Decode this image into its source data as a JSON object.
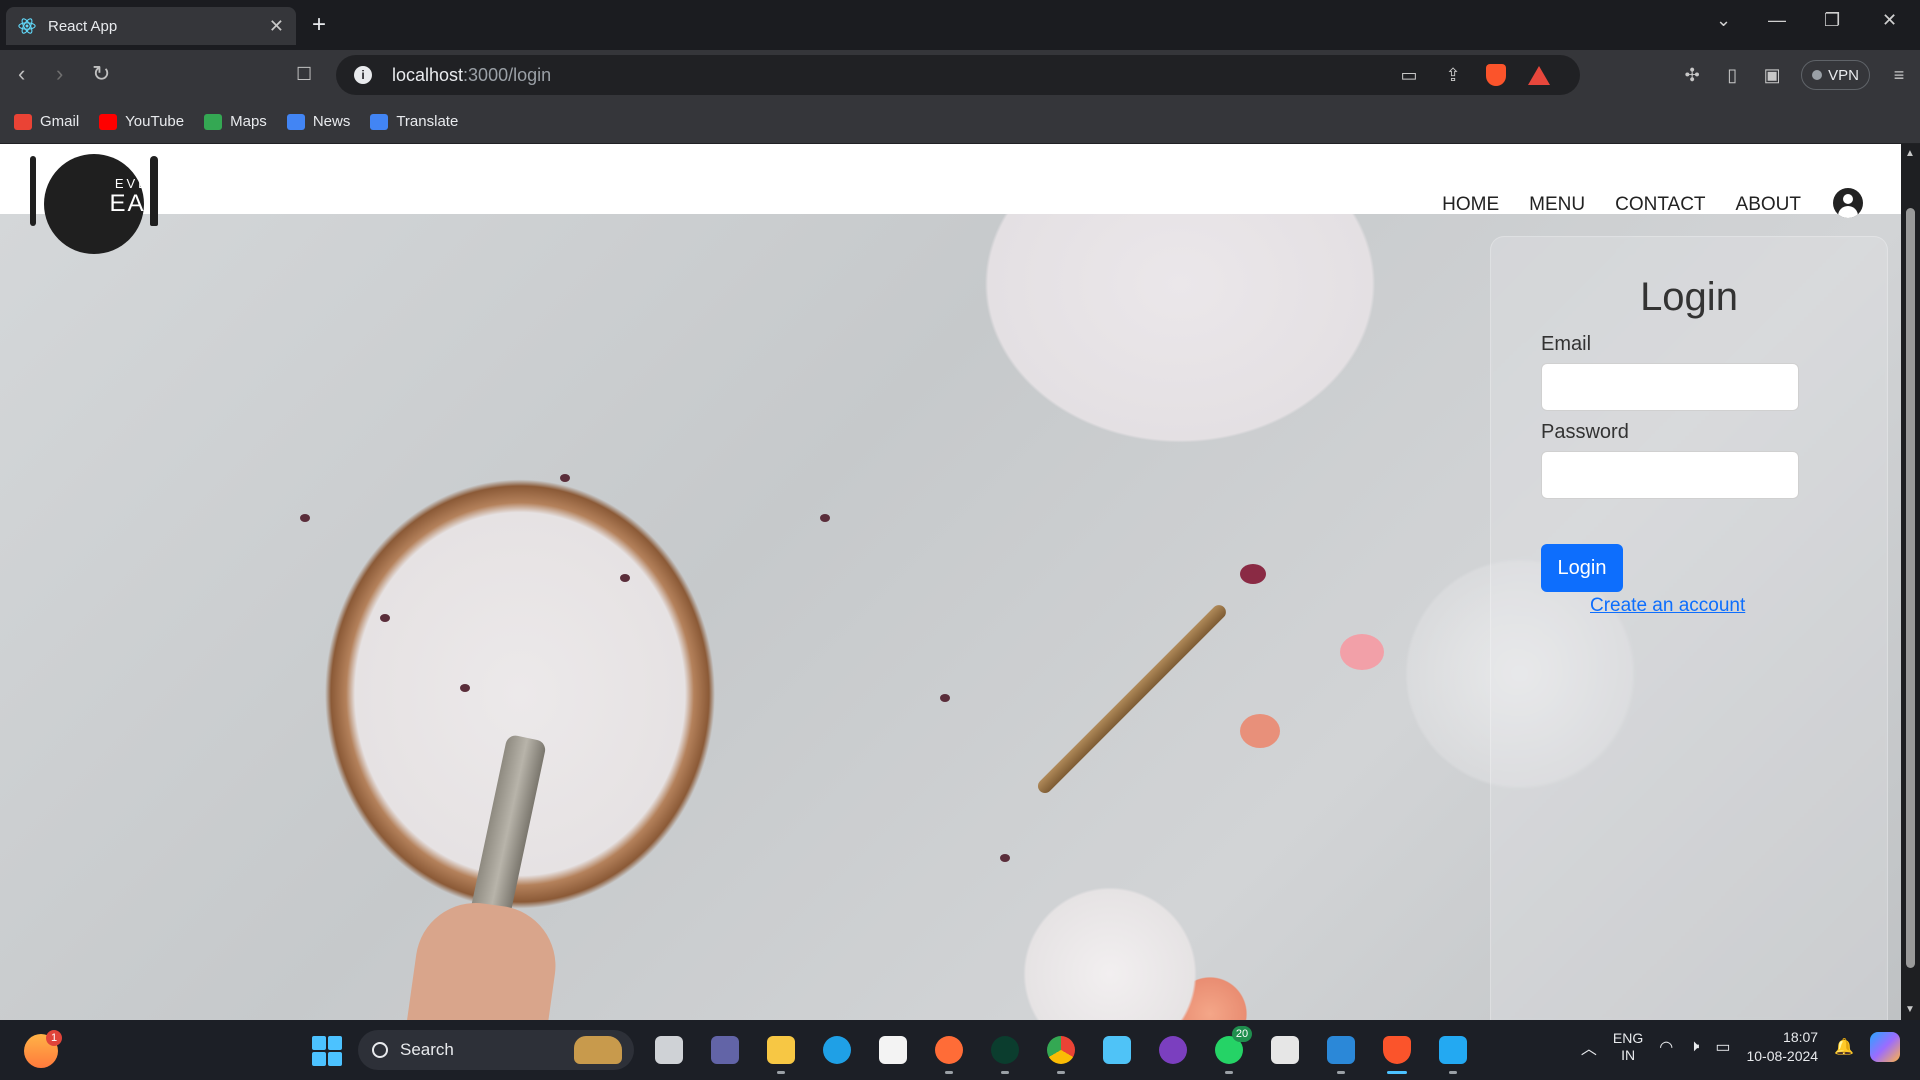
{
  "browser": {
    "tab_title": "React App",
    "url_host": "localhost",
    "url_path": ":3000/login",
    "vpn_label": "VPN",
    "bookmarks": [
      {
        "label": "Gmail",
        "color": "#ea4335"
      },
      {
        "label": "YouTube",
        "color": "#ff0000"
      },
      {
        "label": "Maps",
        "color": "#34a853"
      },
      {
        "label": "News",
        "color": "#4285f4"
      },
      {
        "label": "Translate",
        "color": "#4285f4"
      }
    ]
  },
  "site": {
    "logo_line1": "EVENT",
    "logo_line2": "EATS",
    "nav": [
      "HOME",
      "MENU",
      "CONTACT",
      "ABOUT"
    ]
  },
  "login": {
    "title": "Login",
    "email_label": "Email",
    "email_value": "",
    "password_label": "Password",
    "password_value": "",
    "button_label": "Login",
    "create_link": "Create an account",
    "button_color": "#0d6efd"
  },
  "taskbar": {
    "weather_badge": "1",
    "search_placeholder": "Search",
    "whatsapp_badge": "20",
    "lang_line1": "ENG",
    "lang_line2": "IN",
    "time": "18:07",
    "date": "10-08-2024"
  }
}
